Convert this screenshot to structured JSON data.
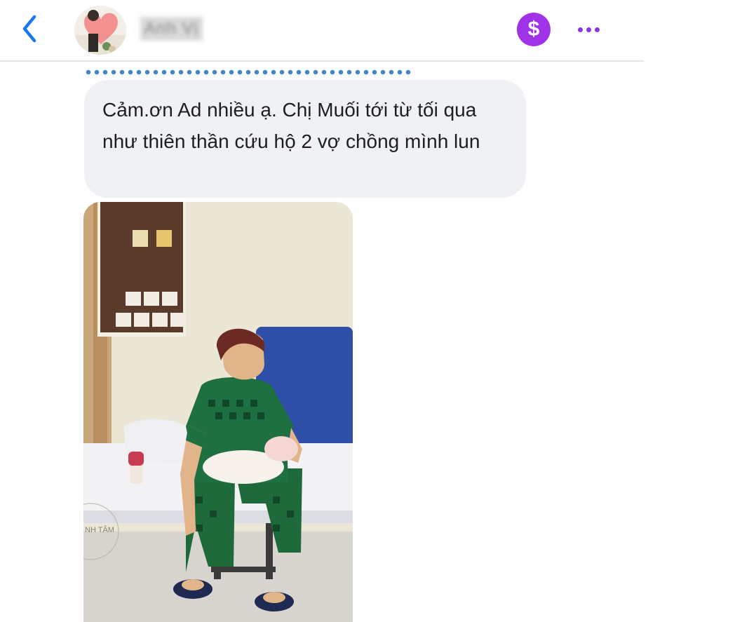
{
  "header": {
    "contact_name": "Anh Vị",
    "pay_icon_symbol": "$",
    "back_icon": "chevron-left-icon",
    "more_icon": "more-horizontal-icon"
  },
  "colors": {
    "accent_blue": "#1877f2",
    "pay_purple": "#a033e8",
    "more_purple": "#8d33e5",
    "bubble_bg": "#f0f1f4",
    "dotted_blue": "#4b86c6"
  },
  "messages": [
    {
      "type": "text",
      "text": "Cảm.ơn Ad nhiều ạ. Chị Muối tới từ tối qua như thiên thần cứu hộ 2 vợ chồng mình lun"
    },
    {
      "type": "photo",
      "watermark": "NH TÂM"
    }
  ]
}
